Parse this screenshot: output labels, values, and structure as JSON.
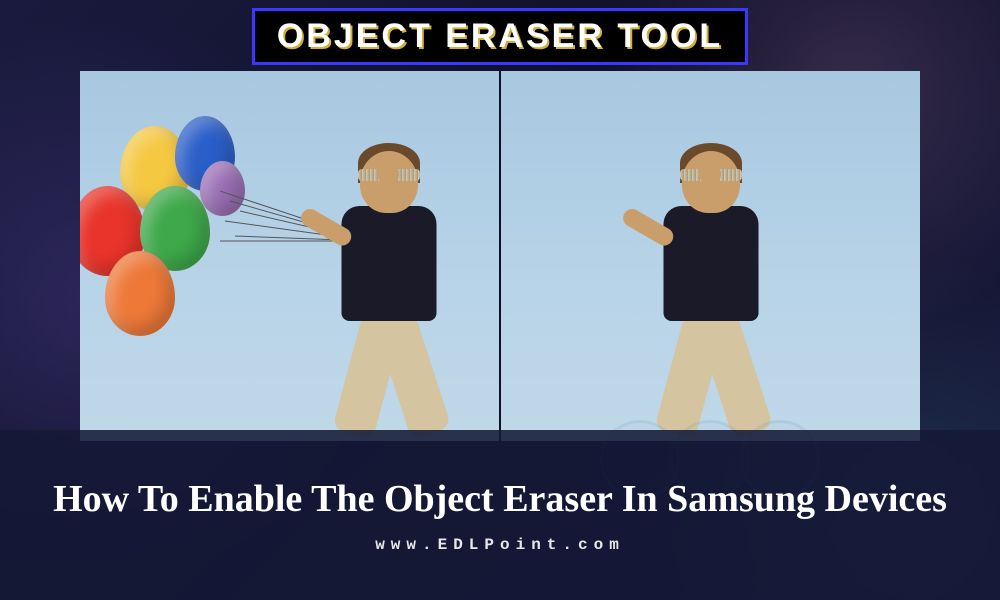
{
  "banner": {
    "title": "OBJECT ERASER TOOL"
  },
  "comparison": {
    "before_label": "before-with-balloons",
    "after_label": "after-balloons-removed",
    "balloons": [
      "red",
      "yellow",
      "blue",
      "green",
      "orange",
      "purple"
    ]
  },
  "article": {
    "title": "How To Enable The Object Eraser In Samsung Devices"
  },
  "site": {
    "url": "www.EDLPoint.com"
  },
  "colors": {
    "banner_border": "#3838ff",
    "banner_bg": "#000000",
    "text_shadow": "#d4af37",
    "overlay_bg": "rgba(20, 25, 55, 0.88)"
  }
}
